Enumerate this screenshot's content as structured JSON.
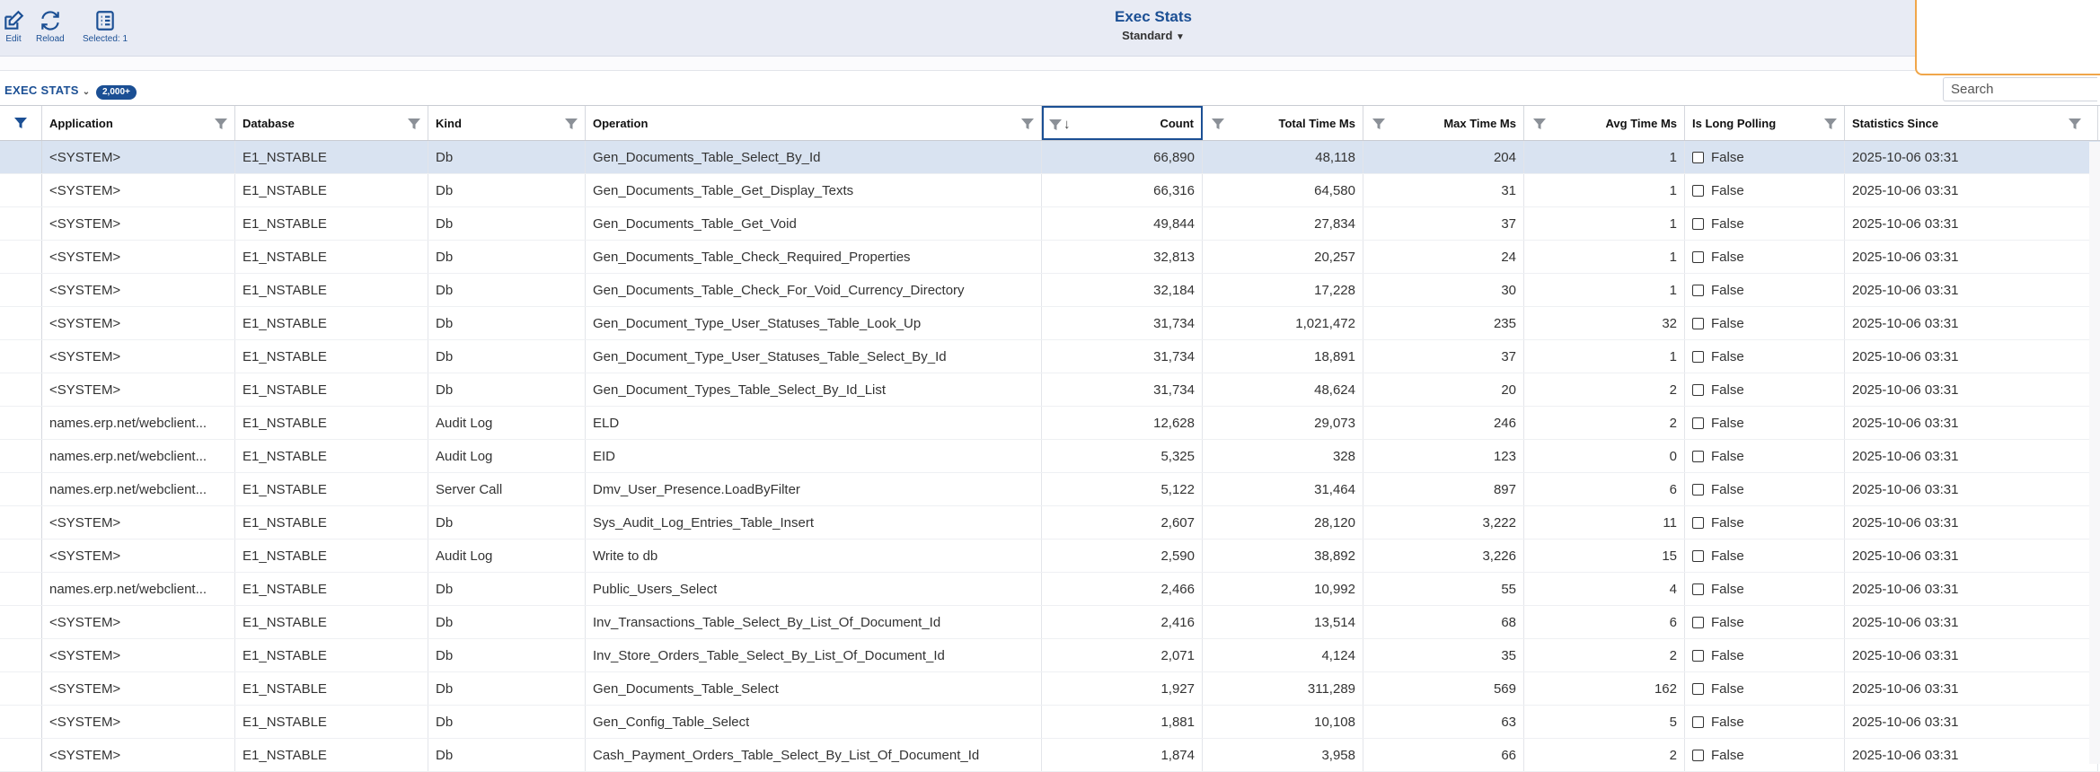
{
  "toolbar": {
    "edit_label": "Edit",
    "reload_label": "Reload",
    "selected_label": "Selected: 1"
  },
  "header": {
    "title": "Exec Stats",
    "view": "Standard"
  },
  "section": {
    "title": "EXEC STATS",
    "badge": "2,000+"
  },
  "search": {
    "placeholder": "Search"
  },
  "colors": {
    "accent": "#1b4f94",
    "selected_row": "#d9e3f1",
    "popup_border": "#f0a64a"
  },
  "grid": {
    "columns": [
      "Application",
      "Database",
      "Kind",
      "Operation",
      "Count",
      "Total Time Ms",
      "Max Time Ms",
      "Avg Time Ms",
      "Is Long Polling",
      "Statistics Since"
    ],
    "sort_indicator": "↓",
    "rows": [
      [
        "<SYSTEM>",
        "E1_NSTABLE",
        "Db",
        "Gen_Documents_Table_Select_By_Id",
        "66,890",
        "48,118",
        "204",
        "1",
        "False",
        "2025-10-06 03:31"
      ],
      [
        "<SYSTEM>",
        "E1_NSTABLE",
        "Db",
        "Gen_Documents_Table_Get_Display_Texts",
        "66,316",
        "64,580",
        "31",
        "1",
        "False",
        "2025-10-06 03:31"
      ],
      [
        "<SYSTEM>",
        "E1_NSTABLE",
        "Db",
        "Gen_Documents_Table_Get_Void",
        "49,844",
        "27,834",
        "37",
        "1",
        "False",
        "2025-10-06 03:31"
      ],
      [
        "<SYSTEM>",
        "E1_NSTABLE",
        "Db",
        "Gen_Documents_Table_Check_Required_Properties",
        "32,813",
        "20,257",
        "24",
        "1",
        "False",
        "2025-10-06 03:31"
      ],
      [
        "<SYSTEM>",
        "E1_NSTABLE",
        "Db",
        "Gen_Documents_Table_Check_For_Void_Currency_Directory",
        "32,184",
        "17,228",
        "30",
        "1",
        "False",
        "2025-10-06 03:31"
      ],
      [
        "<SYSTEM>",
        "E1_NSTABLE",
        "Db",
        "Gen_Document_Type_User_Statuses_Table_Look_Up",
        "31,734",
        "1,021,472",
        "235",
        "32",
        "False",
        "2025-10-06 03:31"
      ],
      [
        "<SYSTEM>",
        "E1_NSTABLE",
        "Db",
        "Gen_Document_Type_User_Statuses_Table_Select_By_Id",
        "31,734",
        "18,891",
        "37",
        "1",
        "False",
        "2025-10-06 03:31"
      ],
      [
        "<SYSTEM>",
        "E1_NSTABLE",
        "Db",
        "Gen_Document_Types_Table_Select_By_Id_List",
        "31,734",
        "48,624",
        "20",
        "2",
        "False",
        "2025-10-06 03:31"
      ],
      [
        "names.erp.net/webclient...",
        "E1_NSTABLE",
        "Audit Log",
        "ELD",
        "12,628",
        "29,073",
        "246",
        "2",
        "False",
        "2025-10-06 03:31"
      ],
      [
        "names.erp.net/webclient...",
        "E1_NSTABLE",
        "Audit Log",
        "EID",
        "5,325",
        "328",
        "123",
        "0",
        "False",
        "2025-10-06 03:31"
      ],
      [
        "names.erp.net/webclient...",
        "E1_NSTABLE",
        "Server Call",
        "Dmv_User_Presence.LoadByFilter",
        "5,122",
        "31,464",
        "897",
        "6",
        "False",
        "2025-10-06 03:31"
      ],
      [
        "<SYSTEM>",
        "E1_NSTABLE",
        "Db",
        "Sys_Audit_Log_Entries_Table_Insert",
        "2,607",
        "28,120",
        "3,222",
        "11",
        "False",
        "2025-10-06 03:31"
      ],
      [
        "<SYSTEM>",
        "E1_NSTABLE",
        "Audit Log",
        "Write to db",
        "2,590",
        "38,892",
        "3,226",
        "15",
        "False",
        "2025-10-06 03:31"
      ],
      [
        "names.erp.net/webclient...",
        "E1_NSTABLE",
        "Db",
        "Public_Users_Select",
        "2,466",
        "10,992",
        "55",
        "4",
        "False",
        "2025-10-06 03:31"
      ],
      [
        "<SYSTEM>",
        "E1_NSTABLE",
        "Db",
        "Inv_Transactions_Table_Select_By_List_Of_Document_Id",
        "2,416",
        "13,514",
        "68",
        "6",
        "False",
        "2025-10-06 03:31"
      ],
      [
        "<SYSTEM>",
        "E1_NSTABLE",
        "Db",
        "Inv_Store_Orders_Table_Select_By_List_Of_Document_Id",
        "2,071",
        "4,124",
        "35",
        "2",
        "False",
        "2025-10-06 03:31"
      ],
      [
        "<SYSTEM>",
        "E1_NSTABLE",
        "Db",
        "Gen_Documents_Table_Select",
        "1,927",
        "311,289",
        "569",
        "162",
        "False",
        "2025-10-06 03:31"
      ],
      [
        "<SYSTEM>",
        "E1_NSTABLE",
        "Db",
        "Gen_Config_Table_Select",
        "1,881",
        "10,108",
        "63",
        "5",
        "False",
        "2025-10-06 03:31"
      ],
      [
        "<SYSTEM>",
        "E1_NSTABLE",
        "Db",
        "Cash_Payment_Orders_Table_Select_By_List_Of_Document_Id",
        "1,874",
        "3,958",
        "66",
        "2",
        "False",
        "2025-10-06 03:31"
      ]
    ]
  }
}
